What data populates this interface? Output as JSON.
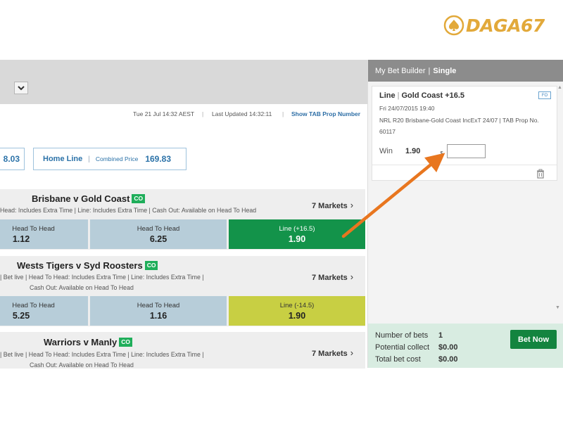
{
  "logo": {
    "text": "DAGA67",
    "color": "#e2a93a"
  },
  "header": {
    "date_time": "Tue 21 Jul 14:32 AEST",
    "last_updated": "Last Updated 14:32:11",
    "prop_link": "Show TAB Prop Number"
  },
  "prices": {
    "left_value": "8.03",
    "home_line_label": "Home Line",
    "combined_label": "Combined Price",
    "combined_value": "169.83"
  },
  "matches": [
    {
      "title": "Brisbane v Gold Coast",
      "badge": "CO",
      "meta1": "Head: Includes Extra Time   |   Line: Includes Extra Time   |   Cash Out: Available on Head To Head",
      "meta2": "",
      "markets": "7 Markets",
      "odds": [
        {
          "label": "Head To Head",
          "value": "1.12"
        },
        {
          "label": "Head To Head",
          "value": "6.25"
        },
        {
          "label": "Line (+16.5)",
          "value": "1.90"
        }
      ]
    },
    {
      "title": "Wests Tigers v Syd Roosters",
      "badge": "CO",
      "meta1": "|   Bet live   |   Head To Head: Includes Extra Time   |   Line: Includes Extra Time   |",
      "meta2": "Cash Out: Available on Head To Head",
      "markets": "7 Markets",
      "odds": [
        {
          "label": "Head To Head",
          "value": "5.25"
        },
        {
          "label": "Head To Head",
          "value": "1.16"
        },
        {
          "label": "Line (-14.5)",
          "value": "1.90"
        }
      ]
    },
    {
      "title": "Warriors v Manly",
      "badge": "CO",
      "meta1": "|   Bet live   |   Head To Head: Includes Extra Time   |   Line: Includes Extra Time   |",
      "meta2": "Cash Out: Available on Head To Head",
      "markets": "7 Markets"
    }
  ],
  "bet_builder": {
    "title": "My Bet Builder",
    "mode": "Single",
    "bet": {
      "market": "Line",
      "selection": "Gold Coast +16.5",
      "badge": "FO",
      "date": "Fri 24/07/2015 19:40",
      "description": "NRL R20 Brisbane-Gold Coast IncExT 24/07 | TAB Prop No. 60117",
      "win_label": "Win",
      "win_value": "1.90",
      "currency": "$",
      "stake": ""
    },
    "summary": {
      "num_bets_label": "Number of bets",
      "num_bets": "1",
      "potential_label": "Potential collect",
      "potential": "$0.00",
      "total_label": "Total bet cost",
      "total": "$0.00",
      "bet_now": "Bet Now"
    }
  },
  "colors": {
    "green_odds": "#13934a",
    "yellow_odds": "#c8cf43",
    "blue_odds": "#b7cdd9",
    "arrow": "#e8761f",
    "bet_now": "#13843f"
  }
}
